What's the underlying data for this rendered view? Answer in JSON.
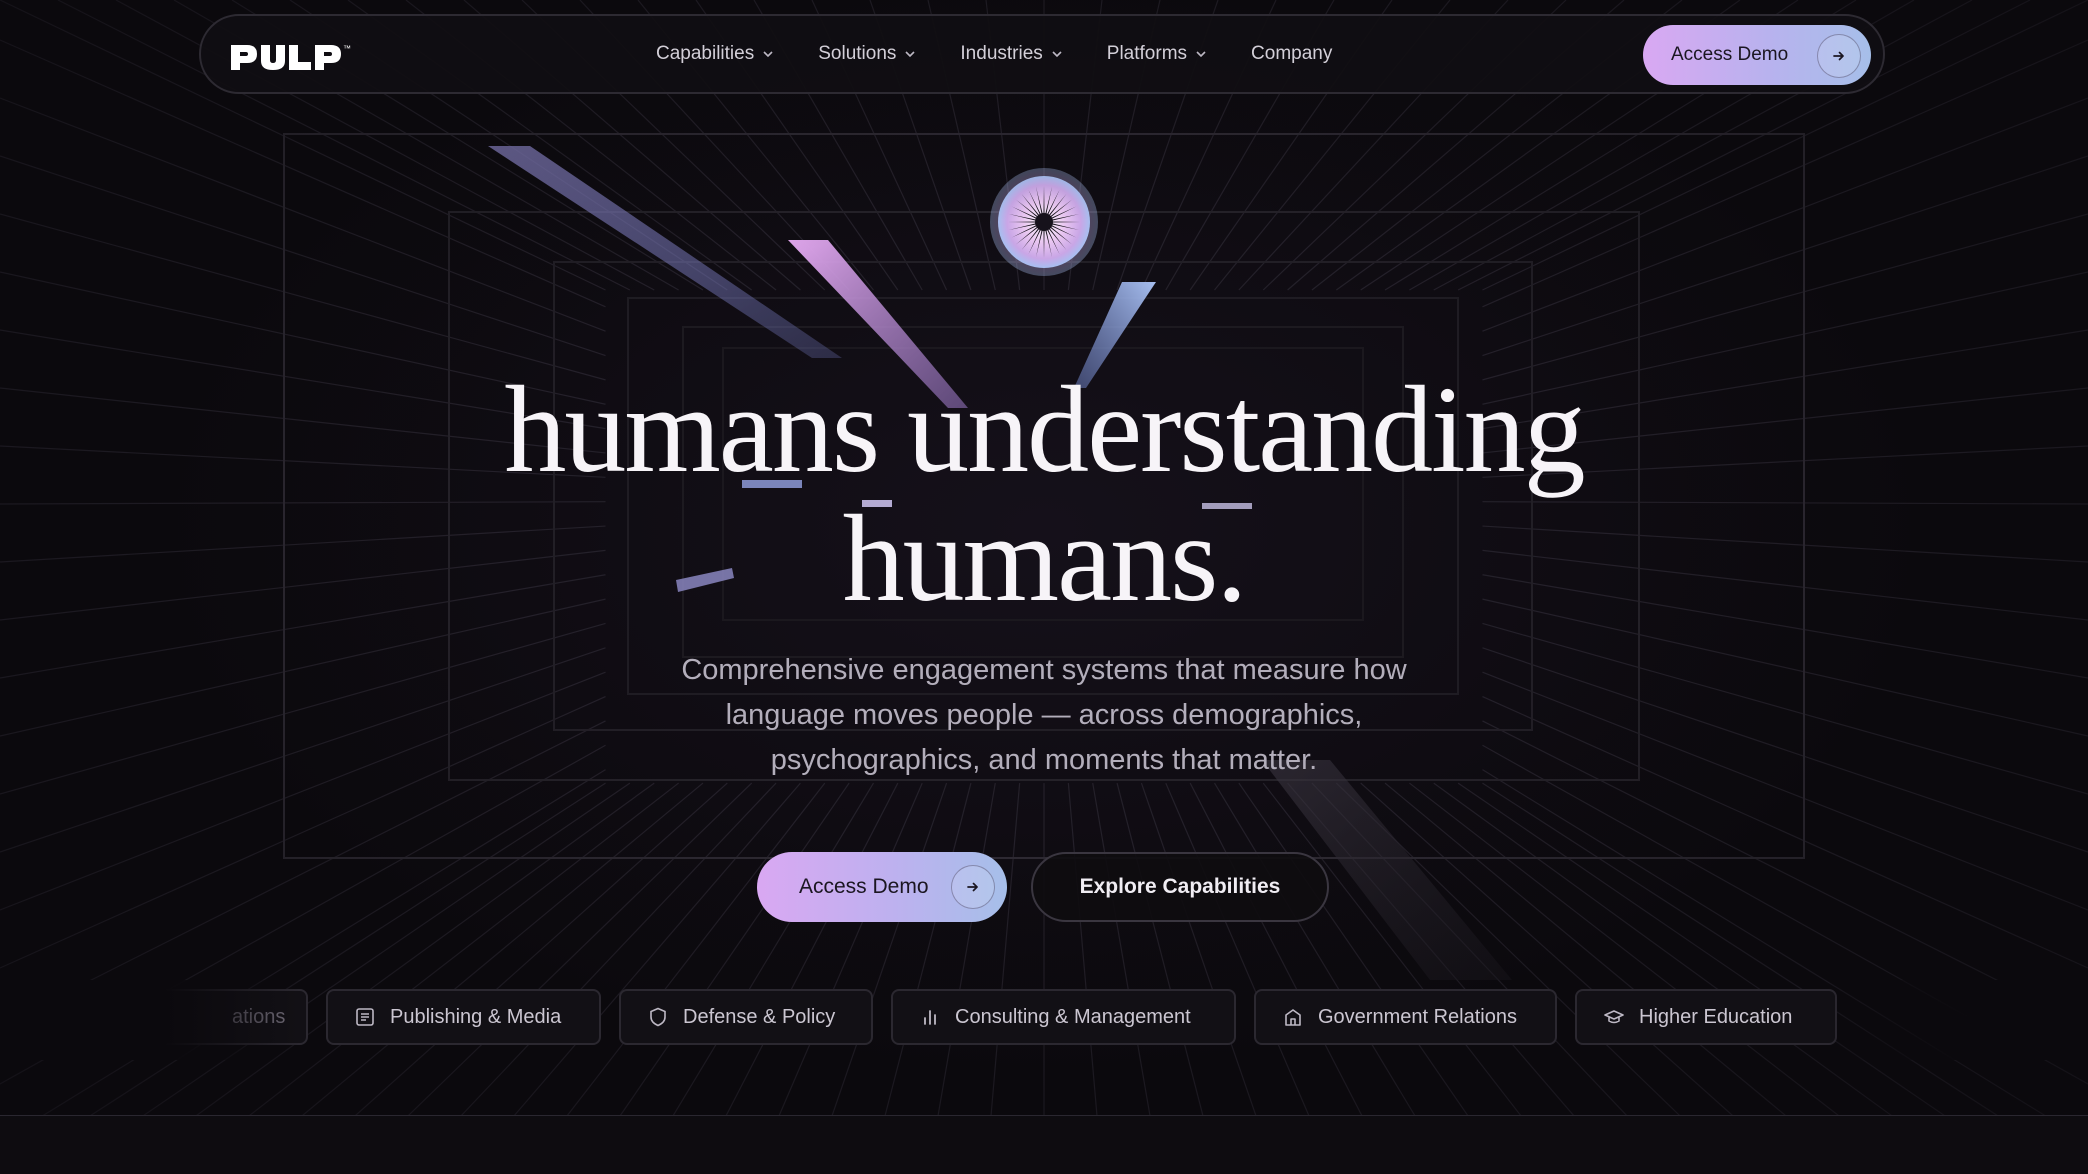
{
  "brand": {
    "logo_text": "PULP",
    "trademark": "™"
  },
  "nav": {
    "links": [
      {
        "label": "Capabilities",
        "has_dropdown": true
      },
      {
        "label": "Solutions",
        "has_dropdown": true
      },
      {
        "label": "Industries",
        "has_dropdown": true
      },
      {
        "label": "Platforms",
        "has_dropdown": true
      },
      {
        "label": "Company",
        "has_dropdown": false
      }
    ],
    "cta_label": "Access Demo"
  },
  "hero": {
    "headline_line1": "humans understanding",
    "headline_line2": "humans.",
    "subheadline": "Comprehensive engagement systems that measure how language moves people — across demographics, psychographics, and moments that matter.",
    "primary_cta": "Access Demo",
    "secondary_cta": "Explore Capabilities"
  },
  "industries": {
    "partial_left_label": "ations",
    "items": [
      {
        "label": "Publishing & Media",
        "icon": "newspaper-icon"
      },
      {
        "label": "Defense & Policy",
        "icon": "shield-icon"
      },
      {
        "label": "Consulting & Management",
        "icon": "bar-chart-icon"
      },
      {
        "label": "Government Relations",
        "icon": "building-icon"
      },
      {
        "label": "Higher Education",
        "icon": "graduation-cap-icon"
      }
    ]
  },
  "colors": {
    "background": "#0b090d",
    "accent_gradient_start": "#d9a8f2",
    "accent_gradient_end": "#a6bfe9",
    "headline": "#f7f4f8",
    "body_text": "#b3aebb"
  }
}
